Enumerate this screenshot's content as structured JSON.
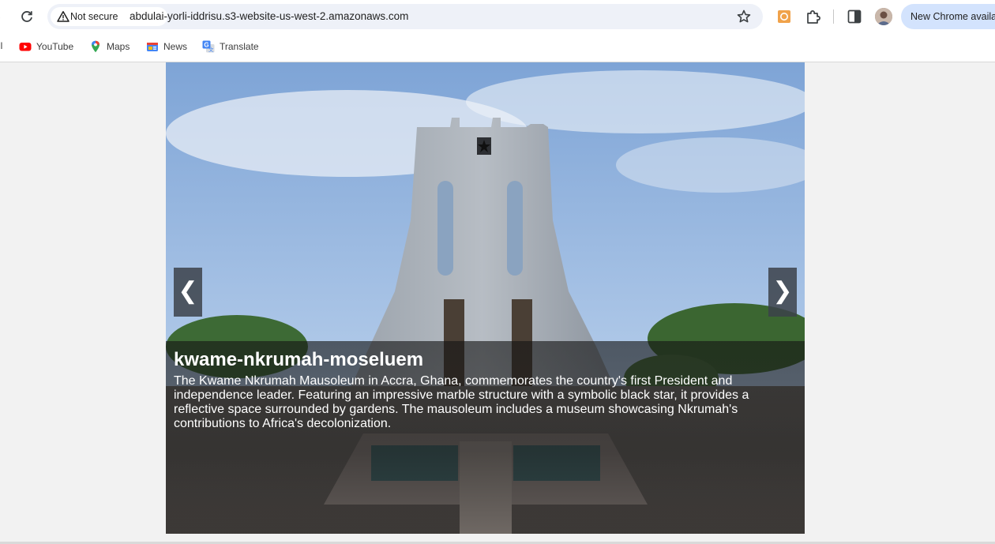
{
  "browser": {
    "security_chip": "Not secure",
    "url": "abdulai-yorli-iddrisu.s3-website-us-west-2.amazonaws.com",
    "update_button": "New Chrome available"
  },
  "bookmarks": {
    "edge_label": "il",
    "items": [
      {
        "label": "YouTube",
        "icon": "youtube-icon"
      },
      {
        "label": "Maps",
        "icon": "maps-pin-icon"
      },
      {
        "label": "News",
        "icon": "news-icon"
      },
      {
        "label": "Translate",
        "icon": "translate-icon"
      }
    ]
  },
  "slideshow": {
    "prev_glyph": "❮",
    "next_glyph": "❯",
    "slide": {
      "title": "kwame-nkrumah-moseluem",
      "description": "The Kwame Nkrumah Mausoleum in Accra, Ghana, commemorates the country's first President and independence leader. Featuring an impressive marble structure with a symbolic black star, it provides a reflective space surrounded by gardens. The mausoleum includes a museum showcasing Nkrumah's contributions to Africa's decolonization."
    }
  },
  "colors": {
    "update_bg": "#d3e3fd",
    "omnibox_bg": "#eef1f8",
    "caption_overlay": "rgba(20,20,20,0.6)"
  }
}
